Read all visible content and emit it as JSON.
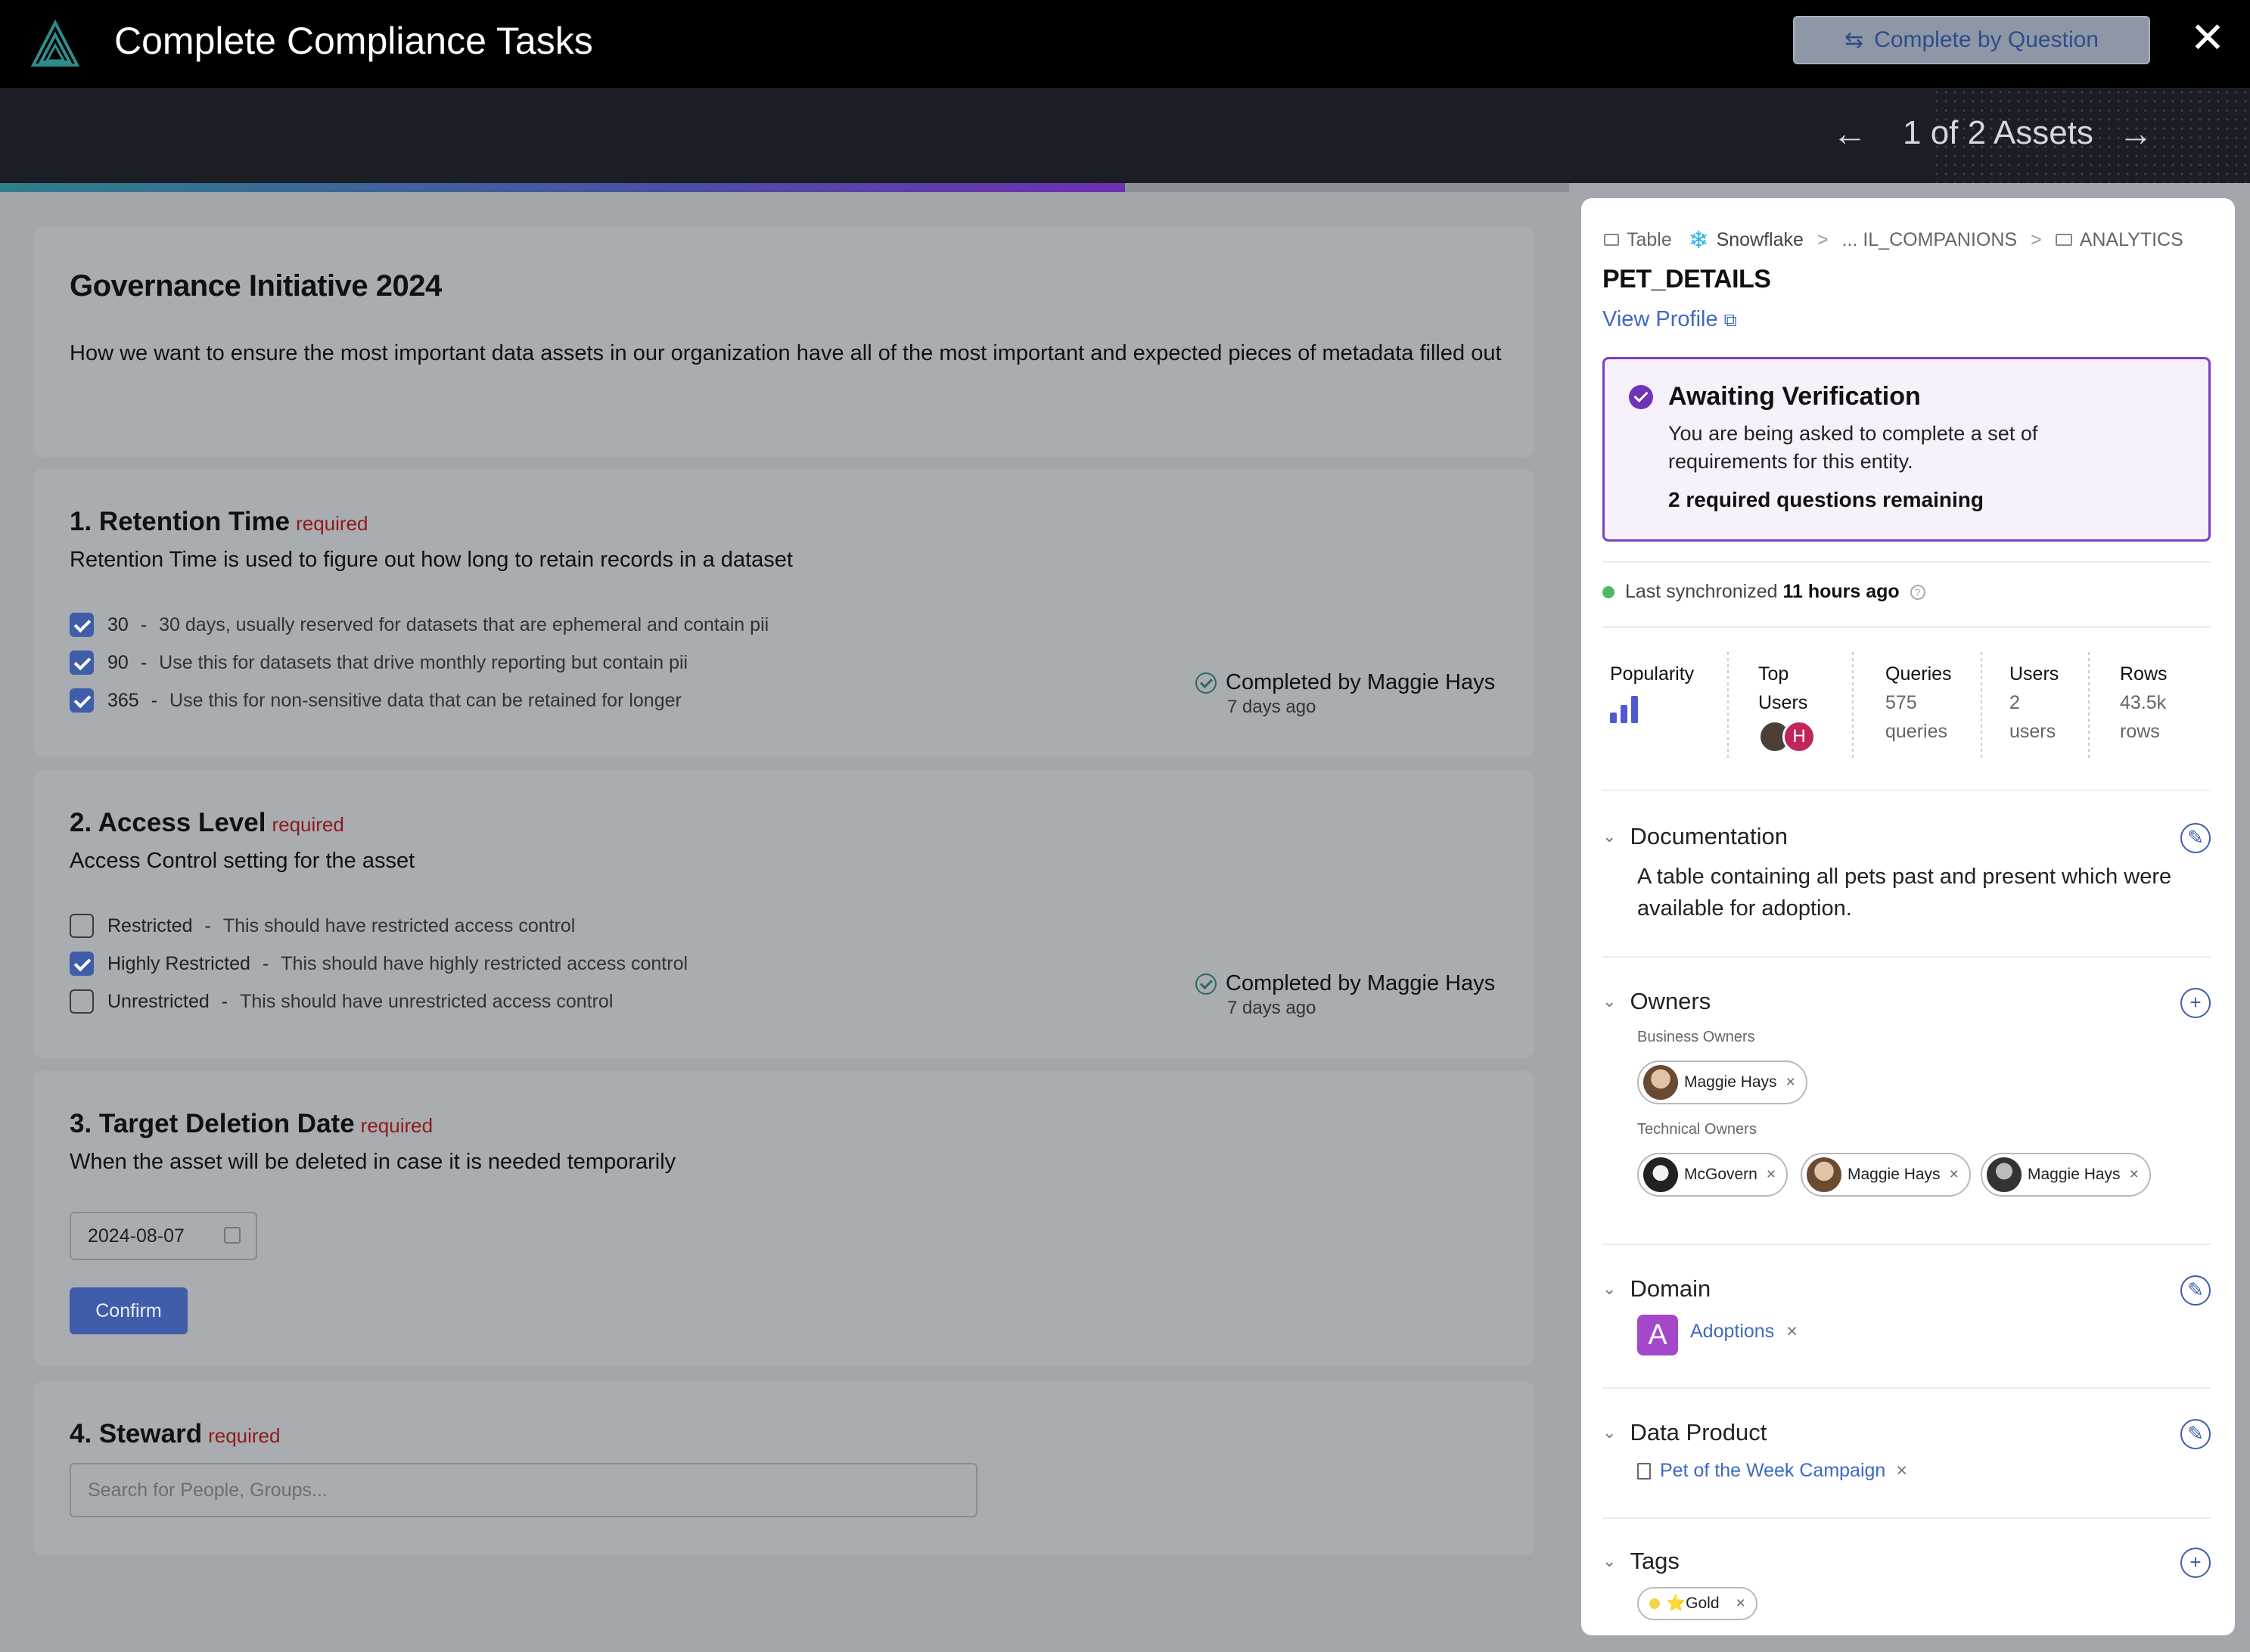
{
  "header": {
    "title": "Complete Compliance Tasks",
    "complete_by_question": "Complete by Question",
    "close": "✕",
    "asset_counter": "1 of 2 Assets",
    "prev": "←",
    "next": "→"
  },
  "progress": {
    "fraction": 0.5
  },
  "initiative": {
    "title": "Governance Initiative 2024",
    "description": "How we want to ensure the most important data assets in our organization have all of the most important and expected pieces of metadata filled out"
  },
  "questions": [
    {
      "title": "1. Retention Time",
      "required": "required",
      "description": "Retention Time is used to figure out how long to retain records in a dataset",
      "options": [
        {
          "value": "30",
          "description": "30 days, usually reserved for datasets that are ephemeral and contain pii",
          "checked": true
        },
        {
          "value": "90",
          "description": "Use this for datasets that drive monthly reporting but contain pii",
          "checked": true
        },
        {
          "value": "365",
          "description": "Use this for non-sensitive data that can be retained for longer",
          "checked": true
        }
      ],
      "completed_by": "Completed by Maggie Hays",
      "completed_ago": "7 days ago"
    },
    {
      "title": "2. Access Level",
      "required": "required",
      "description": "Access Control setting for the asset",
      "options": [
        {
          "value": "Restricted",
          "description": "This should have restricted access control",
          "checked": false
        },
        {
          "value": "Highly Restricted",
          "description": "This should have highly restricted access control",
          "checked": true
        },
        {
          "value": "Unrestricted",
          "description": "This should have unrestricted access control",
          "checked": false
        }
      ],
      "completed_by": "Completed by Maggie Hays",
      "completed_ago": "7 days ago"
    },
    {
      "title": "3. Target Deletion Date",
      "required": "required",
      "description": "When the asset will be deleted in case it is needed temporarily",
      "date_value": "2024-08-07",
      "confirm_label": "Confirm"
    },
    {
      "title": "4. Steward",
      "required": "required",
      "search_placeholder": "Search for People, Groups..."
    }
  ],
  "panel": {
    "breadcrumb": {
      "type": "Table",
      "platform": "Snowflake",
      "sep": ">",
      "path1": "... IL_COMPANIONS",
      "path2": "ANALYTICS"
    },
    "entity_name": "PET_DETAILS",
    "view_profile": "View Profile",
    "verification": {
      "title": "Awaiting Verification",
      "description": "You are being asked to complete a set of requirements for this entity.",
      "remaining": "2 required questions remaining"
    },
    "sync": {
      "label": "Last synchronized",
      "value": "11 hours ago"
    },
    "stats": {
      "popularity_label": "Popularity",
      "popularity_level": 3,
      "top_users_label": "Top Users",
      "top_user_initial": "H",
      "queries_label": "Queries",
      "queries_value": "575",
      "queries_unit": "queries",
      "users_label": "Users",
      "users_value": "2",
      "users_unit": "users",
      "rows_label": "Rows",
      "rows_value": "43.5k",
      "rows_unit": "rows"
    },
    "documentation": {
      "title": "Documentation",
      "text": "A table containing all pets past and present which were available for adoption."
    },
    "owners": {
      "title": "Owners",
      "business_label": "Business Owners",
      "business": [
        "Maggie Hays"
      ],
      "technical_label": "Technical Owners",
      "technical": [
        "McGovern",
        "Maggie Hays",
        "Maggie Hays"
      ]
    },
    "domain": {
      "title": "Domain",
      "initial": "A",
      "name": "Adoptions"
    },
    "data_product": {
      "title": "Data Product",
      "name": "Pet of the Week Campaign"
    },
    "tags": {
      "title": "Tags",
      "items": [
        "⭐Gold"
      ]
    },
    "remove_glyph": "×",
    "edit_glyph": "✎",
    "add_glyph": "+"
  },
  "colors": {
    "accent": "#3f5da8",
    "verification_border": "#7b3fc6",
    "required_text": "#8e1b1b",
    "sync_dot": "#4cb963",
    "domain_badge": "#a248c9"
  }
}
